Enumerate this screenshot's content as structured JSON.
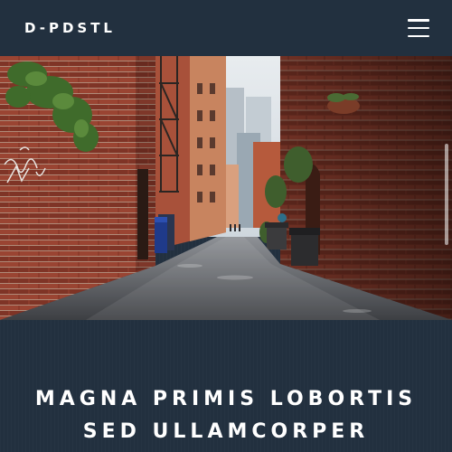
{
  "header": {
    "logo": "D-PDSTL",
    "menu_icon": "hamburger-menu-icon"
  },
  "hero": {
    "image_subject": "brick-alley-photo"
  },
  "article": {
    "title_line_1": "MAGNA PRIMIS LOBORTIS",
    "title_line_2": "SED ULLAMCORPER"
  },
  "colors": {
    "background": "#22303f",
    "text": "#ffffff",
    "brick": "#8a3a2a"
  }
}
